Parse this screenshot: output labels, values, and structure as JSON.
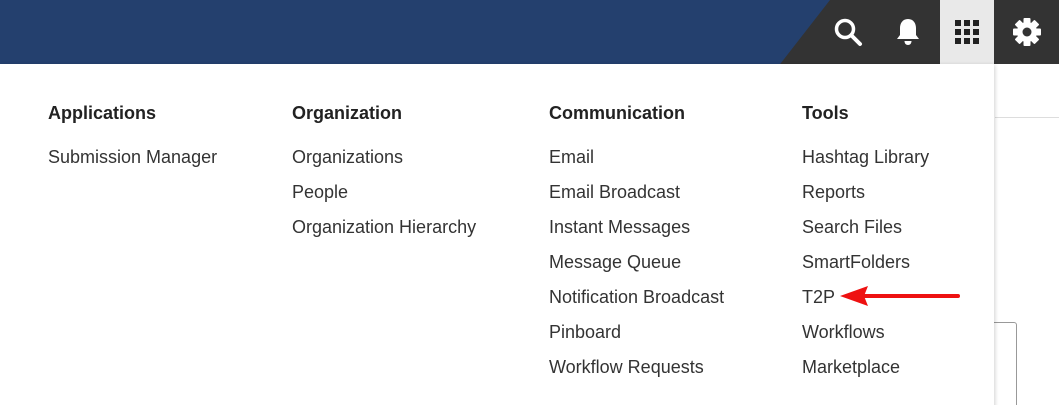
{
  "header": {
    "icons": {
      "search": "search-icon",
      "notifications": "bell-icon",
      "apps": "grid-icon",
      "settings": "gear-icon"
    },
    "colors": {
      "brand": "#24406e",
      "bar": "#333333",
      "active_bg": "#e9e9e9"
    }
  },
  "menu": {
    "columns": [
      {
        "heading": "Applications",
        "items": [
          "Submission Manager"
        ]
      },
      {
        "heading": "Organization",
        "items": [
          "Organizations",
          "People",
          "Organization Hierarchy"
        ]
      },
      {
        "heading": "Communication",
        "items": [
          "Email",
          "Email Broadcast",
          "Instant Messages",
          "Message Queue",
          "Notification Broadcast",
          "Pinboard",
          "Workflow Requests"
        ]
      },
      {
        "heading": "Tools",
        "items": [
          "Hashtag Library",
          "Reports",
          "Search Files",
          "SmartFolders",
          "T2P",
          "Workflows",
          "Marketplace"
        ]
      }
    ]
  },
  "annotation": {
    "arrow_color": "#ee1111",
    "target": "T2P"
  }
}
